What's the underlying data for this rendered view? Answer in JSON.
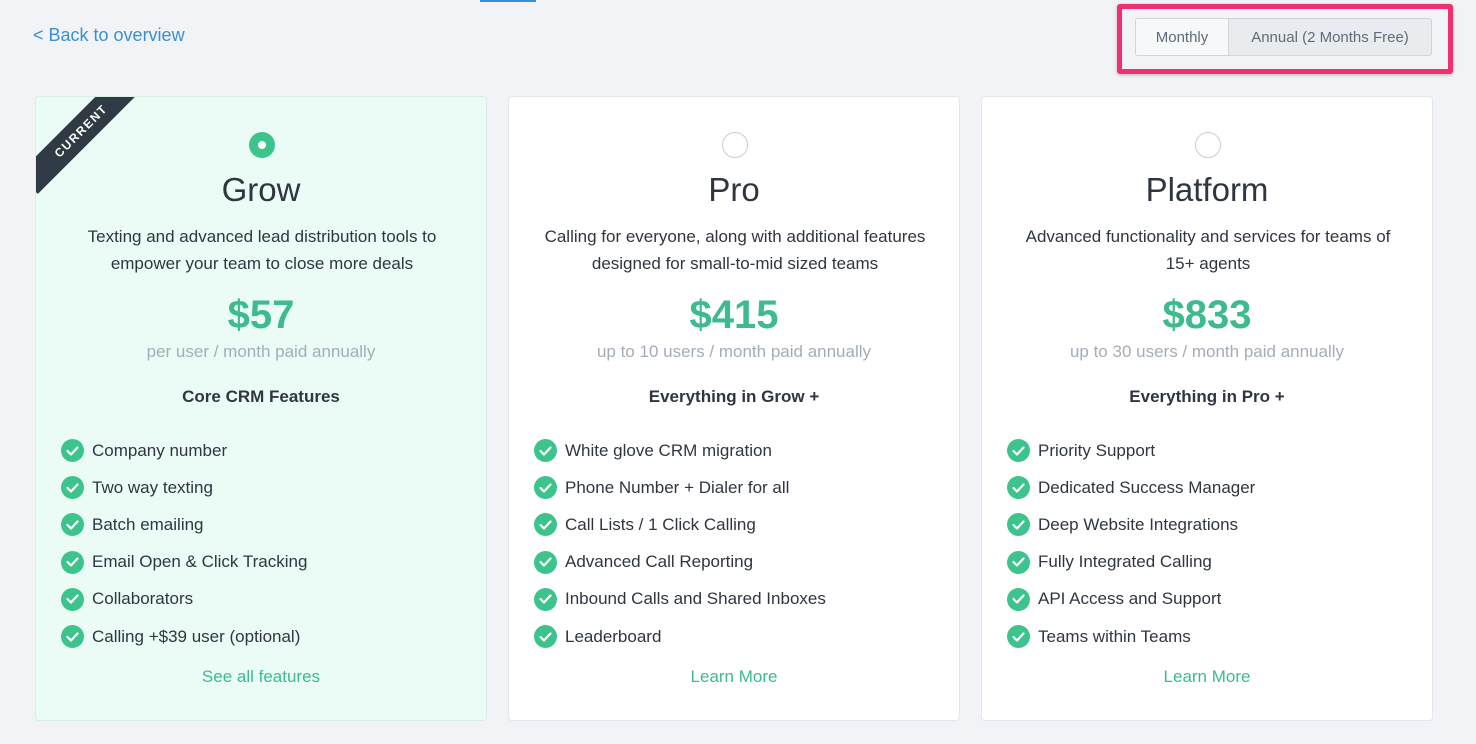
{
  "nav": {
    "back_label": "< Back to overview"
  },
  "billing_toggle": {
    "monthly_label": "Monthly",
    "annual_label": "Annual (2 Months Free)"
  },
  "colors": {
    "accent_green": "#3dbb8c",
    "link_blue": "#3a8fd3",
    "highlight_pink": "#f0306f",
    "current_bg": "#eafcf5"
  },
  "plans": [
    {
      "badge": "CURRENT",
      "name": "Grow",
      "description": "Texting and advanced lead distribution tools to empower your team to close more deals",
      "price": "$57",
      "price_note": "per user / month paid annually",
      "features_heading": "Core CRM Features",
      "features": [
        "Company number",
        "Two way texting",
        "Batch emailing",
        "Email Open & Click Tracking",
        "Collaborators",
        "Calling +$39 user (optional)"
      ],
      "link_label": "See all features"
    },
    {
      "name": "Pro",
      "description": "Calling for everyone, along with additional features designed for small-to-mid sized teams",
      "price": "$415",
      "price_note": "up to 10 users / month paid annually",
      "features_heading": "Everything in Grow +",
      "features": [
        "White glove CRM migration",
        "Phone Number + Dialer for all",
        "Call Lists / 1 Click Calling",
        "Advanced Call Reporting",
        "Inbound Calls and Shared Inboxes",
        "Leaderboard"
      ],
      "link_label": "Learn More"
    },
    {
      "name": "Platform",
      "description": "Advanced functionality and services for teams of 15+ agents",
      "price": "$833",
      "price_note": "up to 30 users / month paid annually",
      "features_heading": "Everything in Pro +",
      "features": [
        "Priority Support",
        "Dedicated Success Manager",
        "Deep Website Integrations",
        "Fully Integrated Calling",
        "API Access and Support",
        "Teams within Teams"
      ],
      "link_label": "Learn More"
    }
  ]
}
